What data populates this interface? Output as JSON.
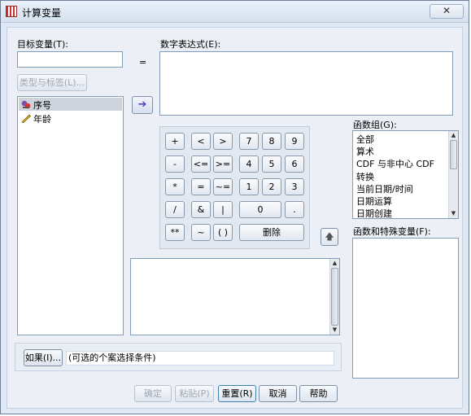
{
  "window": {
    "title": "计算变量",
    "close_glyph": "✕"
  },
  "target_variable": {
    "label": "目标变量(T):",
    "value": "",
    "type_label_button": "类型与标签(L)..."
  },
  "equals_sign": "=",
  "numeric_expression": {
    "label": "数字表达式(E):",
    "value": ""
  },
  "variables": [
    {
      "label": "序号",
      "icon": "ruler-icon"
    },
    {
      "label": "年龄",
      "icon": "pencil-ruler-icon"
    }
  ],
  "move_arrow": "➔",
  "keypad": {
    "rows": [
      [
        "+",
        "<",
        ">",
        "7",
        "8",
        "9"
      ],
      [
        "-",
        "<=",
        ">=",
        "4",
        "5",
        "6"
      ],
      [
        "*",
        "=",
        "~=",
        "1",
        "2",
        "3"
      ],
      [
        "/",
        "&",
        "|",
        "0",
        "."
      ],
      [
        "**",
        "~",
        "( )",
        "删除"
      ]
    ]
  },
  "function_group": {
    "label": "函数组(G):",
    "items": [
      "全部",
      "算术",
      "CDF 与非中心 CDF",
      "转换",
      "当前日期/时间",
      "日期运算",
      "日期创建"
    ]
  },
  "functions_special": {
    "label": "函数和特殊变量(F):"
  },
  "condition": {
    "if_button": "如果(I)...",
    "text": "(可选的个案选择条件)"
  },
  "buttons": {
    "ok": "确定",
    "paste": "粘贴(P)",
    "reset": "重置(R)",
    "cancel": "取消",
    "help": "帮助"
  },
  "up_arrow": "🡅"
}
